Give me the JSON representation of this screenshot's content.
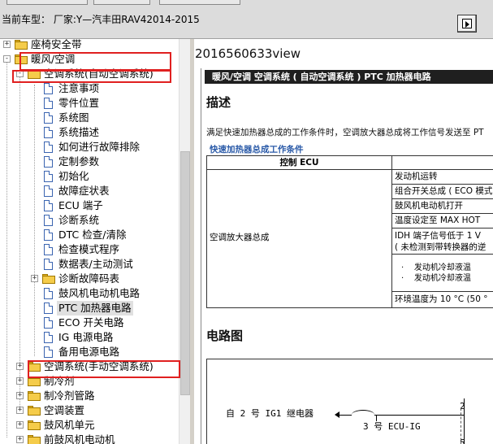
{
  "header": {
    "vehicle_label": "当前车型：  厂家:Y—汽丰田RAV42014-2015"
  },
  "tree": {
    "items": [
      {
        "label": "座椅安全带",
        "level": 0,
        "type": "folder",
        "expander": "+"
      },
      {
        "label": "暖风/空调",
        "level": 0,
        "type": "folder",
        "expander": "-"
      },
      {
        "label": "空调系统(自动空调系统)",
        "level": 1,
        "type": "folder",
        "expander": "-"
      },
      {
        "label": "注意事项",
        "level": 2,
        "type": "doc"
      },
      {
        "label": "零件位置",
        "level": 2,
        "type": "doc"
      },
      {
        "label": "系统图",
        "level": 2,
        "type": "doc"
      },
      {
        "label": "系统描述",
        "level": 2,
        "type": "doc"
      },
      {
        "label": "如何进行故障排除",
        "level": 2,
        "type": "doc"
      },
      {
        "label": "定制参数",
        "level": 2,
        "type": "doc"
      },
      {
        "label": "初始化",
        "level": 2,
        "type": "doc"
      },
      {
        "label": "故障症状表",
        "level": 2,
        "type": "doc"
      },
      {
        "label": "ECU 端子",
        "level": 2,
        "type": "doc"
      },
      {
        "label": "诊断系统",
        "level": 2,
        "type": "doc"
      },
      {
        "label": "DTC 检查/清除",
        "level": 2,
        "type": "doc"
      },
      {
        "label": "检查模式程序",
        "level": 2,
        "type": "doc"
      },
      {
        "label": "数据表/主动测试",
        "level": 2,
        "type": "doc"
      },
      {
        "label": "诊断故障码表",
        "level": 2,
        "type": "folder",
        "expander": "+"
      },
      {
        "label": "鼓风机电动机电路",
        "level": 2,
        "type": "doc"
      },
      {
        "label": "PTC 加热器电路",
        "level": 2,
        "type": "doc",
        "selected": true
      },
      {
        "label": "ECO 开关电路",
        "level": 2,
        "type": "doc"
      },
      {
        "label": "IG 电源电路",
        "level": 2,
        "type": "doc"
      },
      {
        "label": "备用电源电路",
        "level": 2,
        "type": "doc"
      },
      {
        "label": "空调系统(手动空调系统)",
        "level": 1,
        "type": "folder",
        "expander": "+"
      },
      {
        "label": "制冷剂",
        "level": 1,
        "type": "folder",
        "expander": "+"
      },
      {
        "label": "制冷剂管路",
        "level": 1,
        "type": "folder",
        "expander": "+"
      },
      {
        "label": "空调装置",
        "level": 1,
        "type": "folder",
        "expander": "+"
      },
      {
        "label": "鼓风机单元",
        "level": 1,
        "type": "folder",
        "expander": "+"
      },
      {
        "label": "前鼓风机电动机",
        "level": 1,
        "type": "folder",
        "expander": "+"
      }
    ]
  },
  "content": {
    "doc_title": "2016560633view",
    "breadcrumb": "暖风/空调  空调系统 ( 自动空调系统 )   PTC 加热器电路",
    "section_desc": "描述",
    "para": "满足快速加热器总成的工作条件时，空调放大器总成将工作信号发送至 PT",
    "sub_link": "快速加热器总成工作条件",
    "table": {
      "col_header": "控制 ECU",
      "left_cell": "空调放大器总成",
      "rows": [
        "发动机运转",
        "组合开关总成 ( ECO 模式",
        "鼓风机电动机打开",
        "温度设定至 MAX HOT",
        "IDH 端子信号低于 1 V",
        "( 未检测到带转换器的逆",
        "环境温度为 10 °C (50 °"
      ],
      "bullets": [
        "发动机冷却液温",
        "发动机冷却液温"
      ]
    },
    "section_circuit": "电路图",
    "circuit": {
      "from_label": "自 2 号 IG1 继电器",
      "fuse_label": "3 号 ECU-IG",
      "pin_top": "2",
      "pin_bottom": "5"
    }
  }
}
